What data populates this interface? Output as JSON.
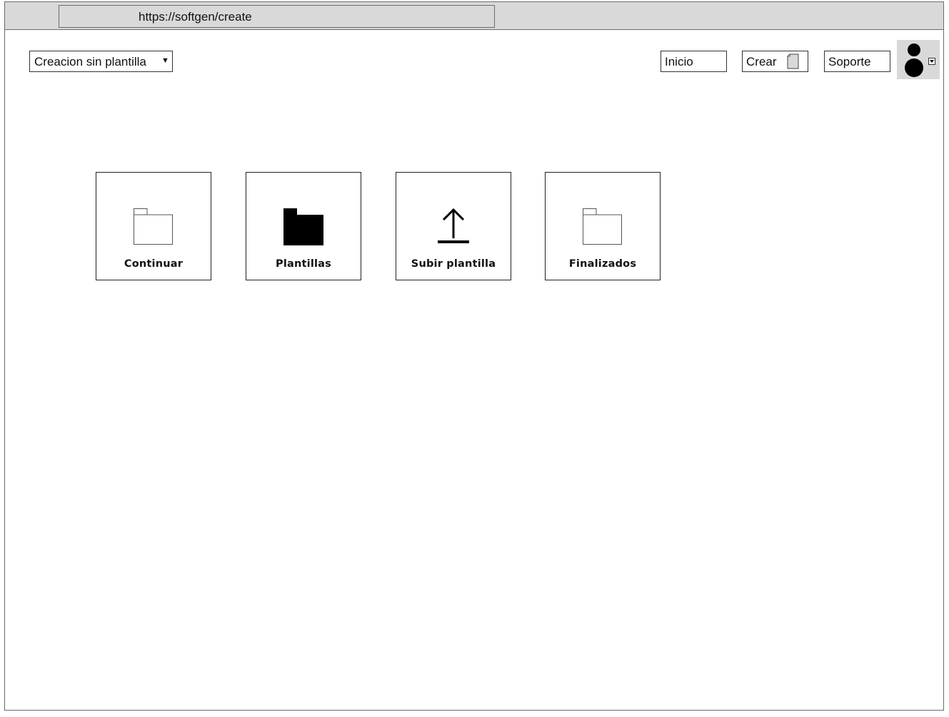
{
  "browser": {
    "url": "https://softgen/create"
  },
  "header": {
    "mode_select": {
      "selected": "Creacion sin plantilla",
      "arrow": "▼"
    },
    "nav": {
      "home_label": "Inicio",
      "create_label": "Crear",
      "support_label": "Soporte"
    },
    "profile": {
      "avatar_icon": "user-avatar-icon",
      "menu_icon": "dropdown-caret-icon"
    }
  },
  "main": {
    "tiles": [
      {
        "label": "Continuar",
        "icon": "folder-outline-icon"
      },
      {
        "label": "Plantillas",
        "icon": "folder-filled-icon"
      },
      {
        "label": "Subir plantilla",
        "icon": "upload-icon"
      },
      {
        "label": "Finalizados",
        "icon": "folder-outline-icon"
      }
    ]
  }
}
